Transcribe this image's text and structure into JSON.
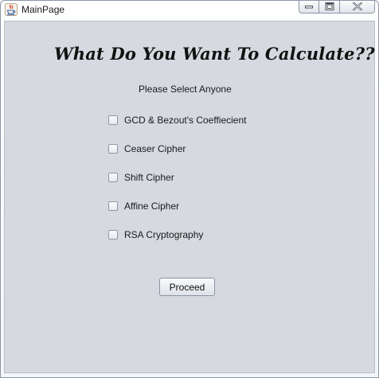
{
  "window": {
    "title": "MainPage",
    "icon": "java-cup-icon",
    "controls": [
      "minimize-icon",
      "restore-icon",
      "close-icon"
    ]
  },
  "main": {
    "heading": "What Do You Want To Calculate??",
    "subheading": "Please Select Anyone",
    "options": [
      {
        "label": "GCD & Bezout's Coeffiecient",
        "checked": false
      },
      {
        "label": "Ceaser Cipher",
        "checked": false
      },
      {
        "label": "Shift Cipher",
        "checked": false
      },
      {
        "label": "Affine Cipher",
        "checked": false
      },
      {
        "label": "RSA Cryptography",
        "checked": false
      }
    ],
    "proceed_label": "Proceed"
  },
  "colors": {
    "panel_background": "#d6d9df",
    "text": "#1a1a1a"
  }
}
